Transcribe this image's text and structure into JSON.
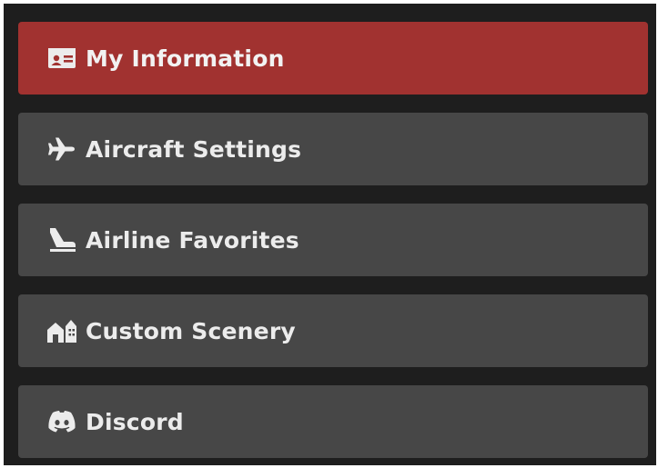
{
  "menu": {
    "items": [
      {
        "label": "My Information",
        "icon": "id-card-icon",
        "active": true
      },
      {
        "label": "Aircraft Settings",
        "icon": "plane-icon",
        "active": false
      },
      {
        "label": "Airline Favorites",
        "icon": "plane-tail-icon",
        "active": false
      },
      {
        "label": "Custom Scenery",
        "icon": "buildings-icon",
        "active": false
      },
      {
        "label": "Discord",
        "icon": "discord-icon",
        "active": false
      }
    ]
  },
  "colors": {
    "panel_background": "#1e1e1e",
    "item_background": "#474747",
    "active_item_background": "#a13230",
    "text": "#ececec"
  }
}
